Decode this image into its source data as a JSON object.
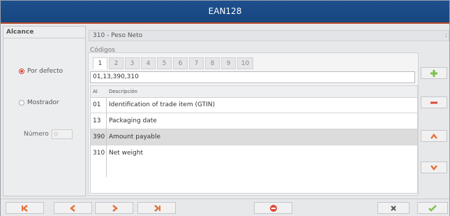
{
  "window": {
    "title": "EAN128"
  },
  "left": {
    "alcance_label": "Alcance",
    "radio_default": "Por defecto",
    "radio_show": "Mostrador",
    "numero_label": "Número",
    "numero_value": "0"
  },
  "combo": {
    "value": "310 - Peso Neto",
    "arrow": ":"
  },
  "codigos": {
    "label": "Códigos",
    "tabs": [
      "1",
      "2",
      "3",
      "4",
      "5",
      "6",
      "7",
      "8",
      "9",
      "10"
    ],
    "active_tab": "1",
    "value": "01,13,390,310"
  },
  "table": {
    "headers": {
      "ai": "AI",
      "desc": "Descripción"
    },
    "rows": [
      {
        "ai": "01",
        "desc": "Identification of trade item (GTIN)"
      },
      {
        "ai": "13",
        "desc": "Packaging date"
      },
      {
        "ai": "390",
        "desc": "Amount payable"
      },
      {
        "ai": "310",
        "desc": "Net weight"
      }
    ],
    "selected_row": 2
  },
  "side_buttons": {
    "add": "plus-icon",
    "remove": "minus-icon",
    "up": "chevron-up-icon",
    "down": "chevron-down-icon"
  },
  "colors": {
    "title_bar": "#1b4a86",
    "accent_red": "#e04a3a",
    "accent_green": "#7cc04a",
    "nav_orange": "#e6733a"
  }
}
